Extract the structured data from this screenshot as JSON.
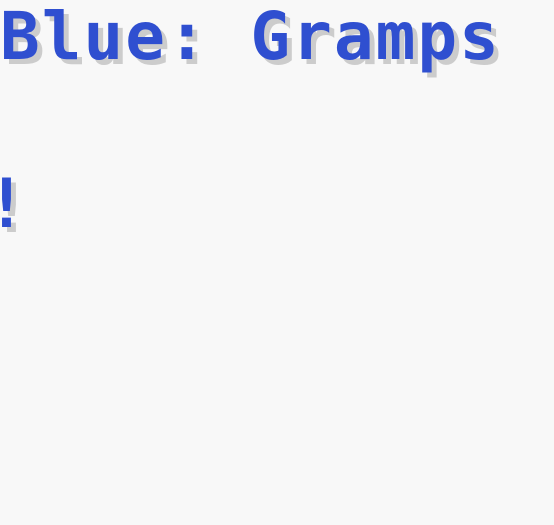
{
  "dialogue": {
    "speaker_line": "Blue: Gramps",
    "second_line": "!"
  },
  "colors": {
    "background": "#f8f8f8",
    "text": "#2f4fd0",
    "shadow": "#cccccc"
  }
}
